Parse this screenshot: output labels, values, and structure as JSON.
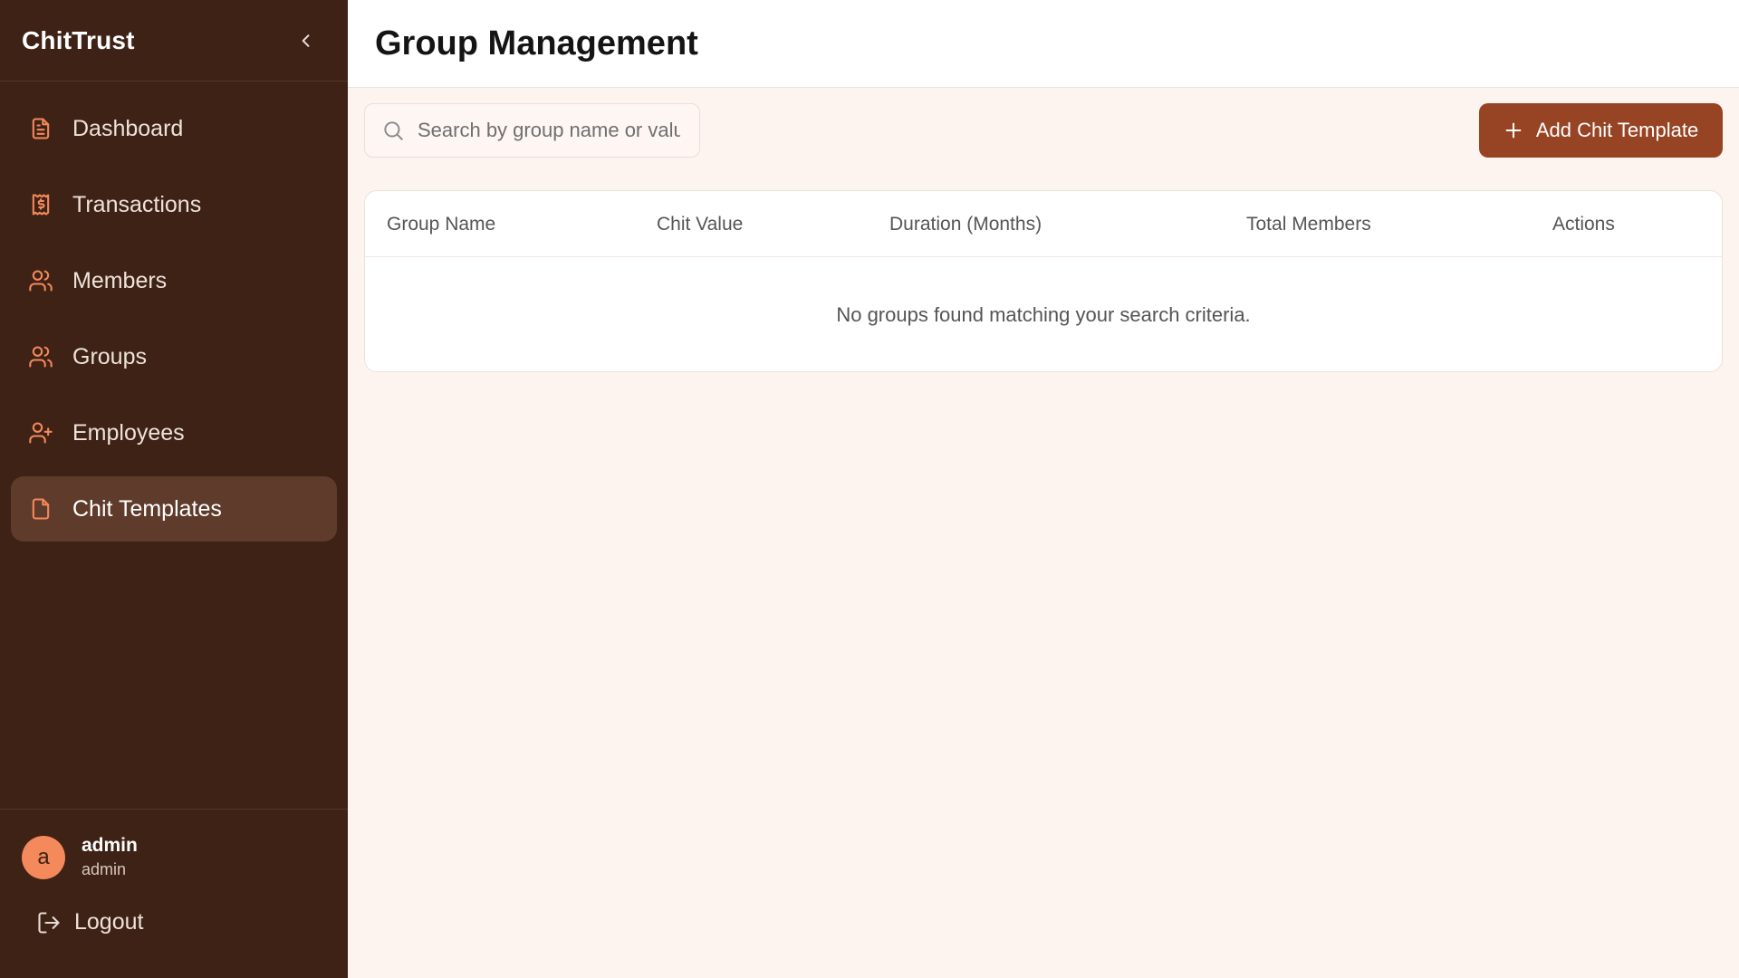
{
  "sidebar": {
    "brand": "ChitTrust",
    "items": [
      {
        "label": "Dashboard",
        "icon": "file-text-icon"
      },
      {
        "label": "Transactions",
        "icon": "receipt-icon"
      },
      {
        "label": "Members",
        "icon": "users-icon"
      },
      {
        "label": "Groups",
        "icon": "users-icon"
      },
      {
        "label": "Employees",
        "icon": "user-plus-icon"
      },
      {
        "label": "Chit Templates",
        "icon": "file-icon",
        "active": true
      }
    ],
    "user": {
      "avatar_letter": "a",
      "name": "admin",
      "role": "admin"
    },
    "logout_label": "Logout"
  },
  "header": {
    "title": "Group Management"
  },
  "toolbar": {
    "search_placeholder": "Search by group name or value",
    "add_label": "Add Chit Template"
  },
  "table": {
    "columns": [
      "Group Name",
      "Chit Value",
      "Duration (Months)",
      "Total Members",
      "Actions"
    ],
    "empty_message": "No groups found matching your search criteria."
  },
  "colors": {
    "sidebar_bg": "#3d2215",
    "sidebar_active": "#5e3b2a",
    "accent_icon": "#f4895b",
    "primary_button": "#974425",
    "content_bg": "#fdf3ef"
  }
}
